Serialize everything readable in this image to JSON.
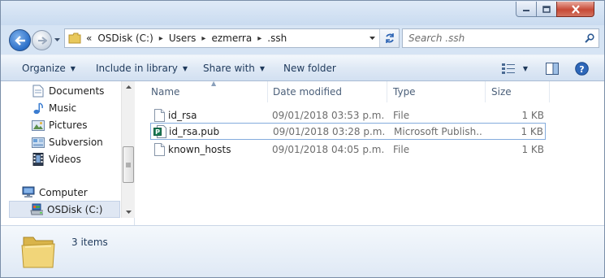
{
  "window": {
    "controls": {
      "minimize": "minimize-icon",
      "maximize": "maximize-icon",
      "close": "close-icon"
    }
  },
  "address": {
    "overflow_glyph": "«",
    "crumbs": [
      "OSDisk (C:)",
      "Users",
      "ezmerra",
      ".ssh"
    ],
    "separator_glyph": "▸"
  },
  "search": {
    "placeholder": "Search .ssh"
  },
  "toolbar": {
    "organize": "Organize",
    "include": "Include in library",
    "share": "Share with",
    "new_folder": "New folder"
  },
  "nav": {
    "items": [
      {
        "label": "Documents",
        "icon": "documents-icon"
      },
      {
        "label": "Music",
        "icon": "music-icon"
      },
      {
        "label": "Pictures",
        "icon": "pictures-icon"
      },
      {
        "label": "Subversion",
        "icon": "subversion-icon"
      },
      {
        "label": "Videos",
        "icon": "videos-icon"
      }
    ],
    "computer": "Computer",
    "drive": "OSDisk (C:)"
  },
  "columns": {
    "name": "Name",
    "date": "Date modified",
    "type": "Type",
    "size": "Size"
  },
  "files": [
    {
      "name": "id_rsa",
      "date": "09/01/2018 03:53 p.m.",
      "type": "File",
      "size": "1 KB",
      "icon": "file-icon"
    },
    {
      "name": "id_rsa.pub",
      "date": "09/01/2018 03:28 p.m.",
      "type": "Microsoft Publish...",
      "size": "1 KB",
      "icon": "publisher-file-icon"
    },
    {
      "name": "known_hosts",
      "date": "09/01/2018 04:05 p.m.",
      "type": "File",
      "size": "1 KB",
      "icon": "file-icon"
    }
  ],
  "details": {
    "count": "3 items"
  },
  "colors": {
    "accent": "#1e395b",
    "selection": "#84acdd",
    "close": "#c74a37"
  }
}
